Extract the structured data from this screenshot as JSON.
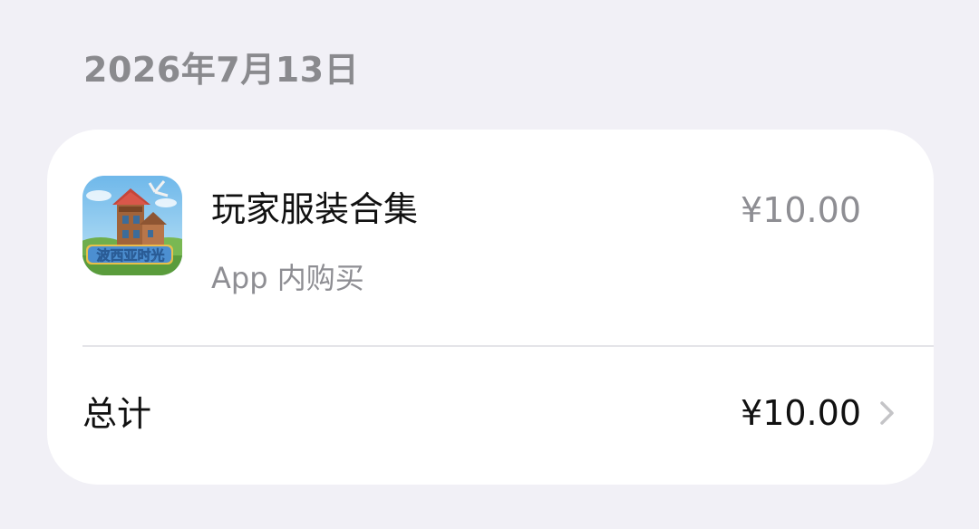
{
  "date_header": "2026年7月13日",
  "purchase": {
    "icon": "game-app-icon",
    "icon_text": "波西亚时光",
    "title": "玩家服装合集",
    "subtitle": "App 内购买",
    "price": "¥10.00"
  },
  "total": {
    "label": "总计",
    "price": "¥10.00",
    "chevron_icon": "chevron-right-icon"
  },
  "colors": {
    "background": "#f1f0f6",
    "card": "#ffffff",
    "secondary_text": "#8e8e93",
    "primary_text": "#111111"
  }
}
